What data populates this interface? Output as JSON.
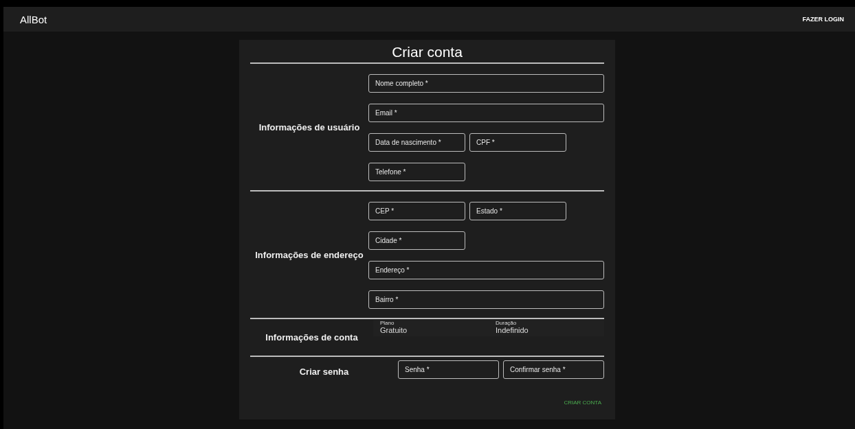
{
  "app_bar": {
    "title": "AllBot",
    "login_button": "FAZER LOGIN"
  },
  "form": {
    "title": "Criar conta",
    "sections": [
      {
        "kind": "fields",
        "heading": "Informações de usuário",
        "rows": [
          [
            {
              "placeholder": "Nome completo *",
              "kind": "full"
            }
          ],
          [
            {
              "placeholder": "Email *",
              "kind": "full"
            }
          ],
          [
            {
              "placeholder": "Data de nascimento *",
              "kind": "half"
            },
            {
              "placeholder": "CPF *",
              "kind": "half"
            }
          ],
          [
            {
              "placeholder": "Telefone *",
              "kind": "half"
            }
          ]
        ]
      },
      {
        "kind": "fields",
        "heading": "Informações de endereço",
        "rows": [
          [
            {
              "placeholder": "CEP *",
              "kind": "half"
            },
            {
              "placeholder": "Estado *",
              "kind": "half"
            }
          ],
          [
            {
              "placeholder": "Cidade *",
              "kind": "half"
            }
          ],
          [
            {
              "placeholder": "Endereço *",
              "kind": "full"
            }
          ],
          [
            {
              "placeholder": "Bairro *",
              "kind": "full"
            }
          ]
        ]
      },
      {
        "kind": "info",
        "heading": "Informações de conta",
        "items": [
          {
            "label": "Plano",
            "value": "Gratuito"
          },
          {
            "label": "Duração",
            "value": "Indefinido"
          }
        ]
      },
      {
        "kind": "password",
        "heading": "Criar senha",
        "rows": [
          [
            {
              "placeholder": "Senha *",
              "kind": "half"
            },
            {
              "placeholder": "Confirmar senha *",
              "kind": "half"
            }
          ]
        ]
      }
    ],
    "submit_button": "CRIAR CONTA"
  }
}
